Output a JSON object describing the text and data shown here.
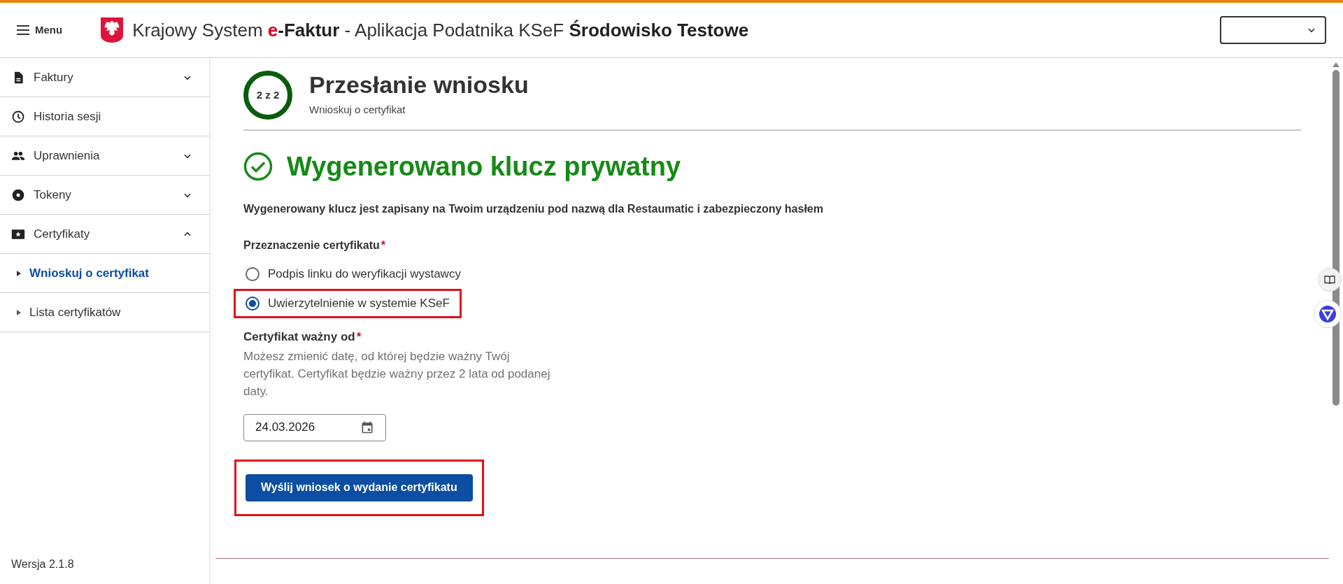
{
  "header": {
    "menu_label": "Menu",
    "title": [
      {
        "text": "Krajowy System ",
        "kind": "plain"
      },
      {
        "text": "e",
        "kind": "accent"
      },
      {
        "text": "-Faktur",
        "kind": "strong"
      },
      {
        "text": " - Aplikacja Podatnika KSeF ",
        "kind": "plain"
      },
      {
        "text": "Środowisko Testowe",
        "kind": "strong"
      }
    ]
  },
  "sidebar": {
    "items": [
      {
        "label": "Faktury",
        "expanded": false
      },
      {
        "label": "Historia sesji"
      },
      {
        "label": "Uprawnienia",
        "expanded": false
      },
      {
        "label": "Tokeny",
        "expanded": false
      },
      {
        "label": "Certyfikaty",
        "expanded": true,
        "children": [
          {
            "label": "Wnioskuj o certyfikat",
            "selected": true
          },
          {
            "label": "Lista certyfikatów",
            "selected": false
          }
        ]
      }
    ],
    "version": "Wersja 2.1.8"
  },
  "step": {
    "counter": "2 z 2",
    "title": "Przesłanie wniosku",
    "subtitle": "Wnioskuj o certyfikat"
  },
  "success": {
    "heading": "Wygenerowano klucz prywatny",
    "message": "Wygenerowany klucz jest zapisany na Twoim urządzeniu pod nazwą dla Restaumatic i zabezpieczony hasłem"
  },
  "purpose": {
    "label": "Przeznaczenie certyfikatu",
    "required_mark": "*",
    "options": [
      {
        "label": "Podpis linku do weryfikacji wystawcy",
        "selected": false,
        "highlighted": false
      },
      {
        "label": "Uwierzytelnienie w systemie KSeF",
        "selected": true,
        "highlighted": true
      }
    ]
  },
  "valid_from": {
    "label": "Certyfikat ważny od",
    "required_mark": "*",
    "help": "Możesz zmienić datę, od której będzie ważny Twój certyfikat. Certyfikat będzie ważny przez 2 lata od podanej daty.",
    "value": "24.03.2026"
  },
  "submit": {
    "label": "Wyślij wniosek o wydanie certyfikatu",
    "highlighted": true
  }
}
